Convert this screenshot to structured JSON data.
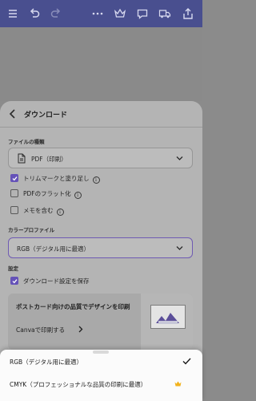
{
  "toolbar": {
    "icons": [
      "menu-icon",
      "undo-icon",
      "redo-icon",
      "more-icon",
      "crown-icon",
      "comment-icon",
      "truck-icon",
      "share-icon"
    ],
    "background": "#494f8f"
  },
  "sheet": {
    "title": "ダウンロード",
    "file_type": {
      "label": "ファイルの種類",
      "value": "PDF（印刷）"
    },
    "options": [
      {
        "label": "トリムマークと塗り足し",
        "checked": true,
        "info": true
      },
      {
        "label": "PDFのフラット化",
        "checked": false,
        "info": true
      },
      {
        "label": "メモを含む",
        "checked": false,
        "info": true
      }
    ],
    "color_profile": {
      "label": "カラープロファイル",
      "value": "RGB（デジタル用に最適）"
    },
    "settings": {
      "label": "設定",
      "save_option": {
        "label": "ダウンロード設定を保存",
        "checked": true
      }
    },
    "promo": {
      "title": "ポストカード向けの品質でデザインを印刷",
      "link": "Canvaで印刷する"
    }
  },
  "dropdown": {
    "options": [
      {
        "label": "RGB（デジタル用に最適）",
        "selected": true
      },
      {
        "label": "CMYK（プロフェッショナルな品質の印刷に最適）",
        "pro": true
      }
    ]
  },
  "colors": {
    "accent": "#6552b8",
    "crown": "#f2b21c"
  }
}
